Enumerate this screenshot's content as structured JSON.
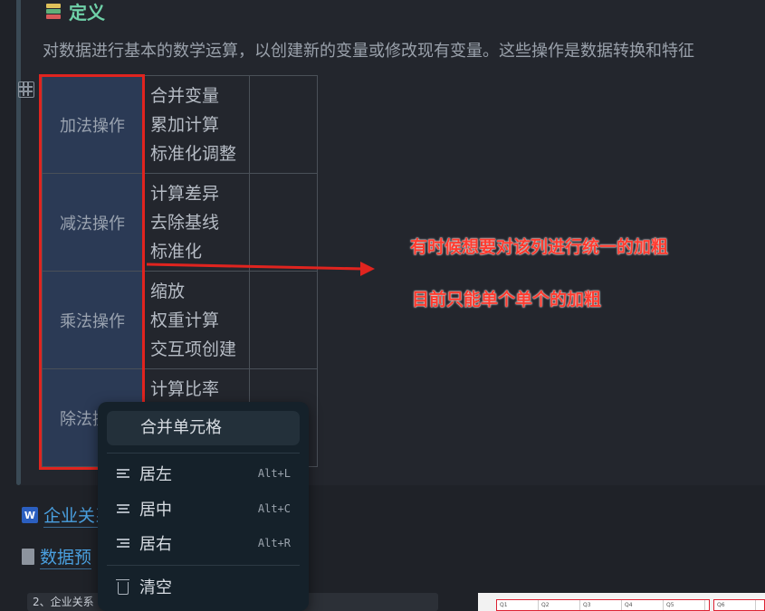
{
  "section": {
    "title": "定义",
    "description": "对数据进行基本的数学运算，以创建新的变量或修改现有变量。这些操作是数据转换和特征"
  },
  "table": {
    "rows": [
      {
        "head": "加法操作",
        "items": [
          "合并变量",
          "累加计算",
          "标准化调整"
        ]
      },
      {
        "head": "减法操作",
        "items": [
          "计算差异",
          "去除基线",
          "标准化"
        ]
      },
      {
        "head": "乘法操作",
        "items": [
          "缩放",
          "权重计算",
          "交互项创建"
        ]
      },
      {
        "head": "除法操作",
        "items": [
          "计算比率"
        ]
      }
    ]
  },
  "annotations": {
    "note1": "有时候想要对该列进行统一的加粗",
    "note2": "目前只能单个单个的加粗",
    "color": "#ff3b2f"
  },
  "links": {
    "doc1": "企业关系……影响研究.doc",
    "doc2": "数据预"
  },
  "code_preview": "2、企业关系",
  "context_menu": {
    "merge": "合并单元格",
    "items": [
      {
        "label": "居左",
        "shortcut": "Alt+L"
      },
      {
        "label": "居中",
        "shortcut": "Alt+C"
      },
      {
        "label": "居右",
        "shortcut": "Alt+R"
      }
    ],
    "clear": "清空"
  },
  "thumbnail": {
    "cells": [
      "Q1",
      "Q2",
      "Q3",
      "Q4",
      "Q5"
    ],
    "extra": "Q6"
  }
}
